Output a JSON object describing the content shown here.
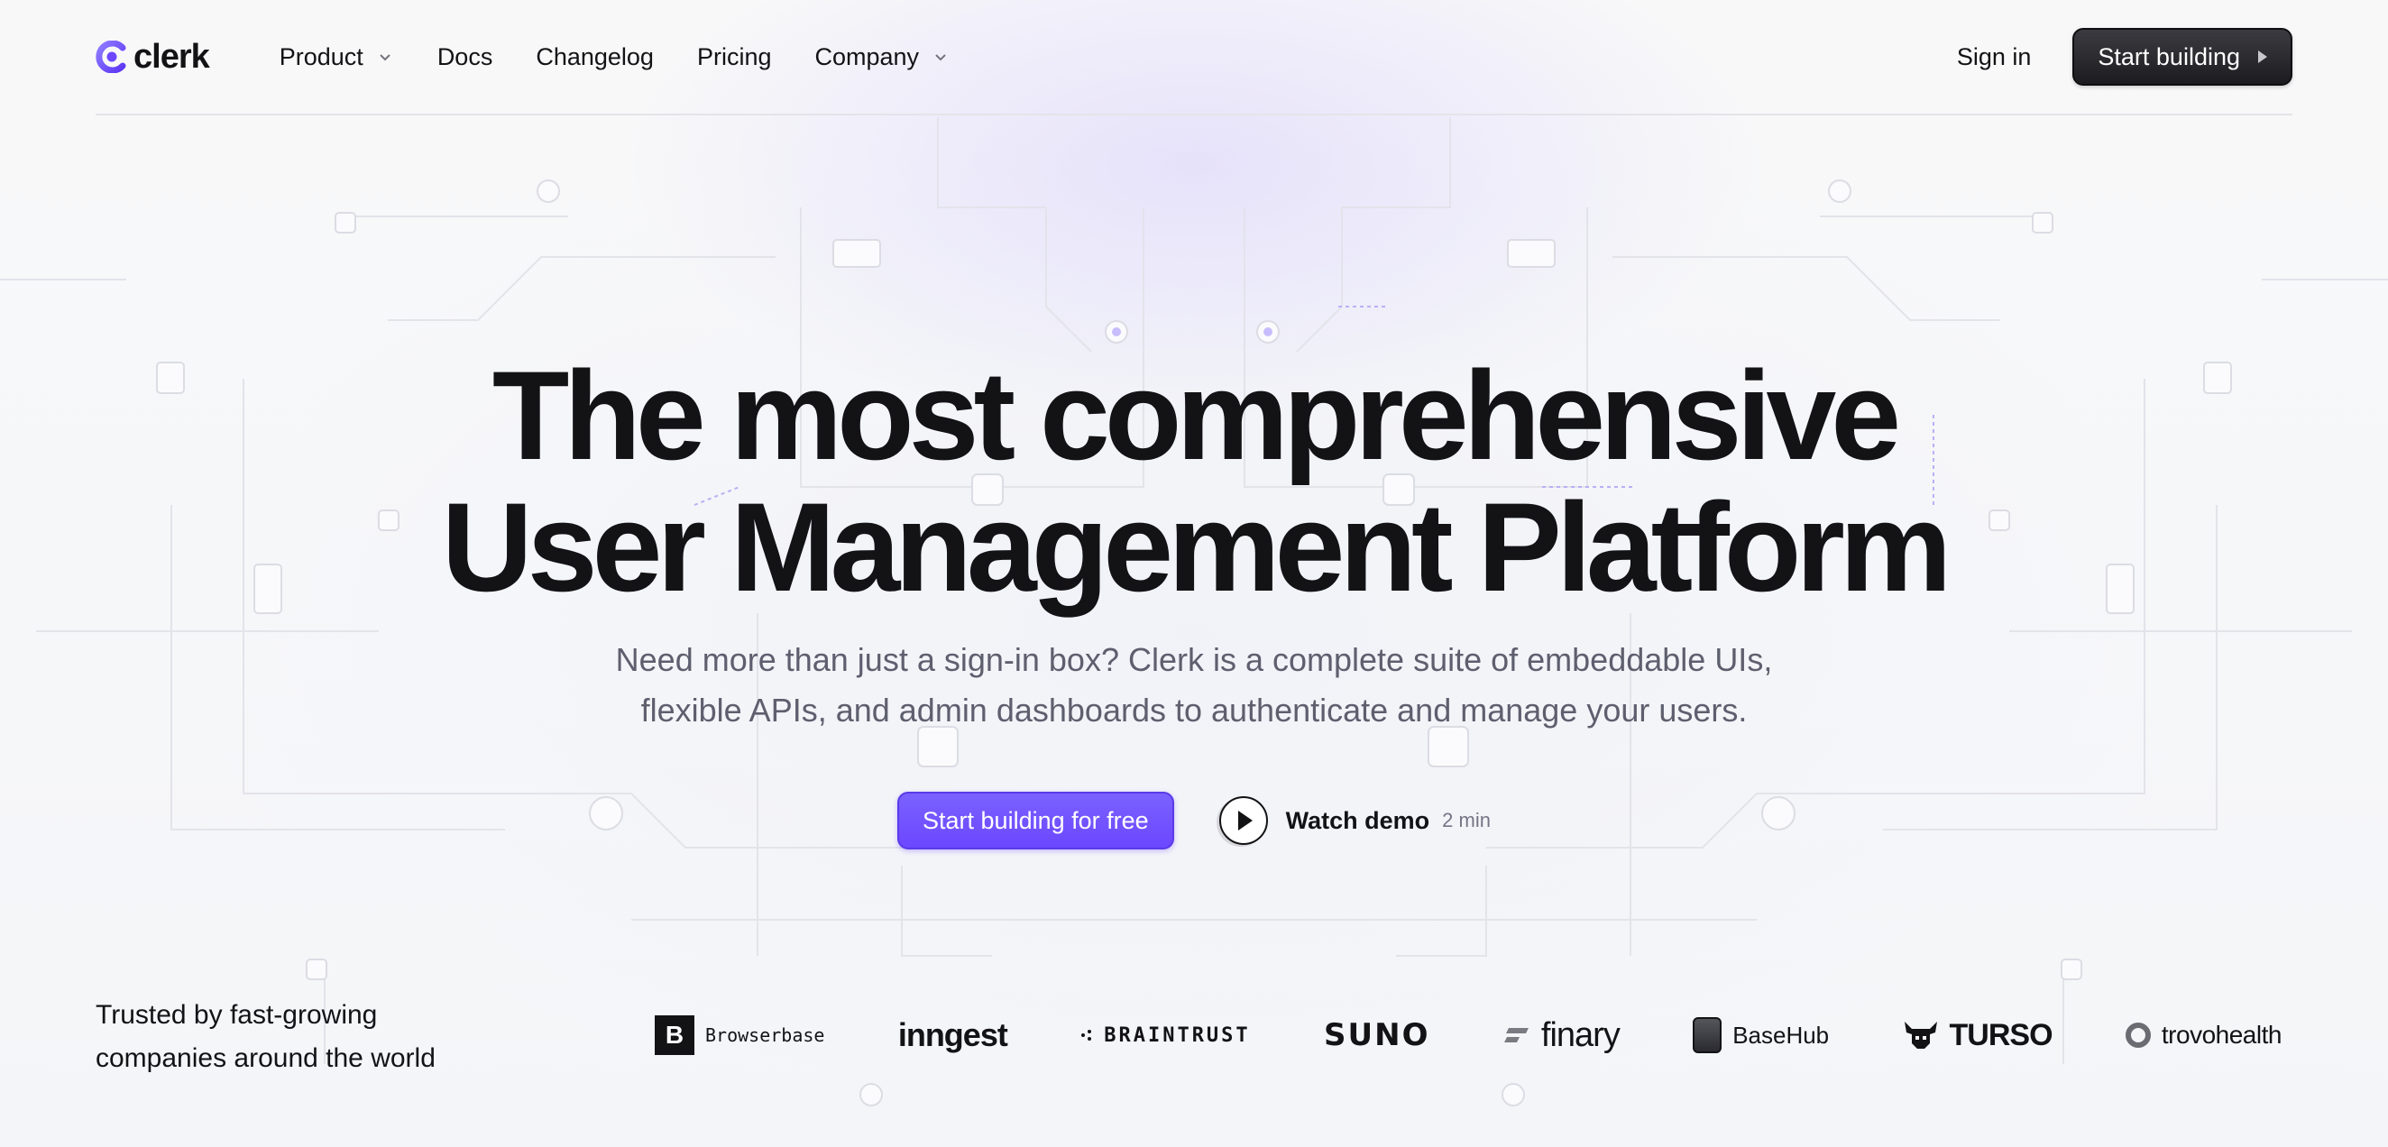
{
  "nav": {
    "logo_text": "clerk",
    "items": [
      {
        "label": "Product",
        "has_dropdown": true
      },
      {
        "label": "Docs",
        "has_dropdown": false
      },
      {
        "label": "Changelog",
        "has_dropdown": false
      },
      {
        "label": "Pricing",
        "has_dropdown": false
      },
      {
        "label": "Company",
        "has_dropdown": true
      }
    ],
    "sign_in": "Sign in",
    "start_building": "Start building"
  },
  "hero": {
    "title_line1": "The most comprehensive",
    "title_line2": "User Management Platform",
    "subtitle_line1": "Need more than just a sign-in box? Clerk is a complete suite of embeddable UIs,",
    "subtitle_line2": "flexible APIs, and admin dashboards to authenticate and manage your users.",
    "primary_cta": "Start building for free",
    "watch_demo": "Watch demo",
    "watch_duration": "2 min"
  },
  "trusted": {
    "line1": "Trusted by fast-growing",
    "line2": "companies around the world",
    "logos": [
      {
        "name": "Browserbase",
        "mark": "B"
      },
      {
        "name": "inngest"
      },
      {
        "name": "BRAINTRUST"
      },
      {
        "name": "SUNO"
      },
      {
        "name": "finary"
      },
      {
        "name": "BaseHub"
      },
      {
        "name": "TURSO"
      },
      {
        "name": "trovohealth"
      }
    ]
  },
  "colors": {
    "brand_purple": "#6c47ff",
    "text_primary": "#131316",
    "text_secondary": "#5e5f6e",
    "background": "#f7f7f8"
  }
}
